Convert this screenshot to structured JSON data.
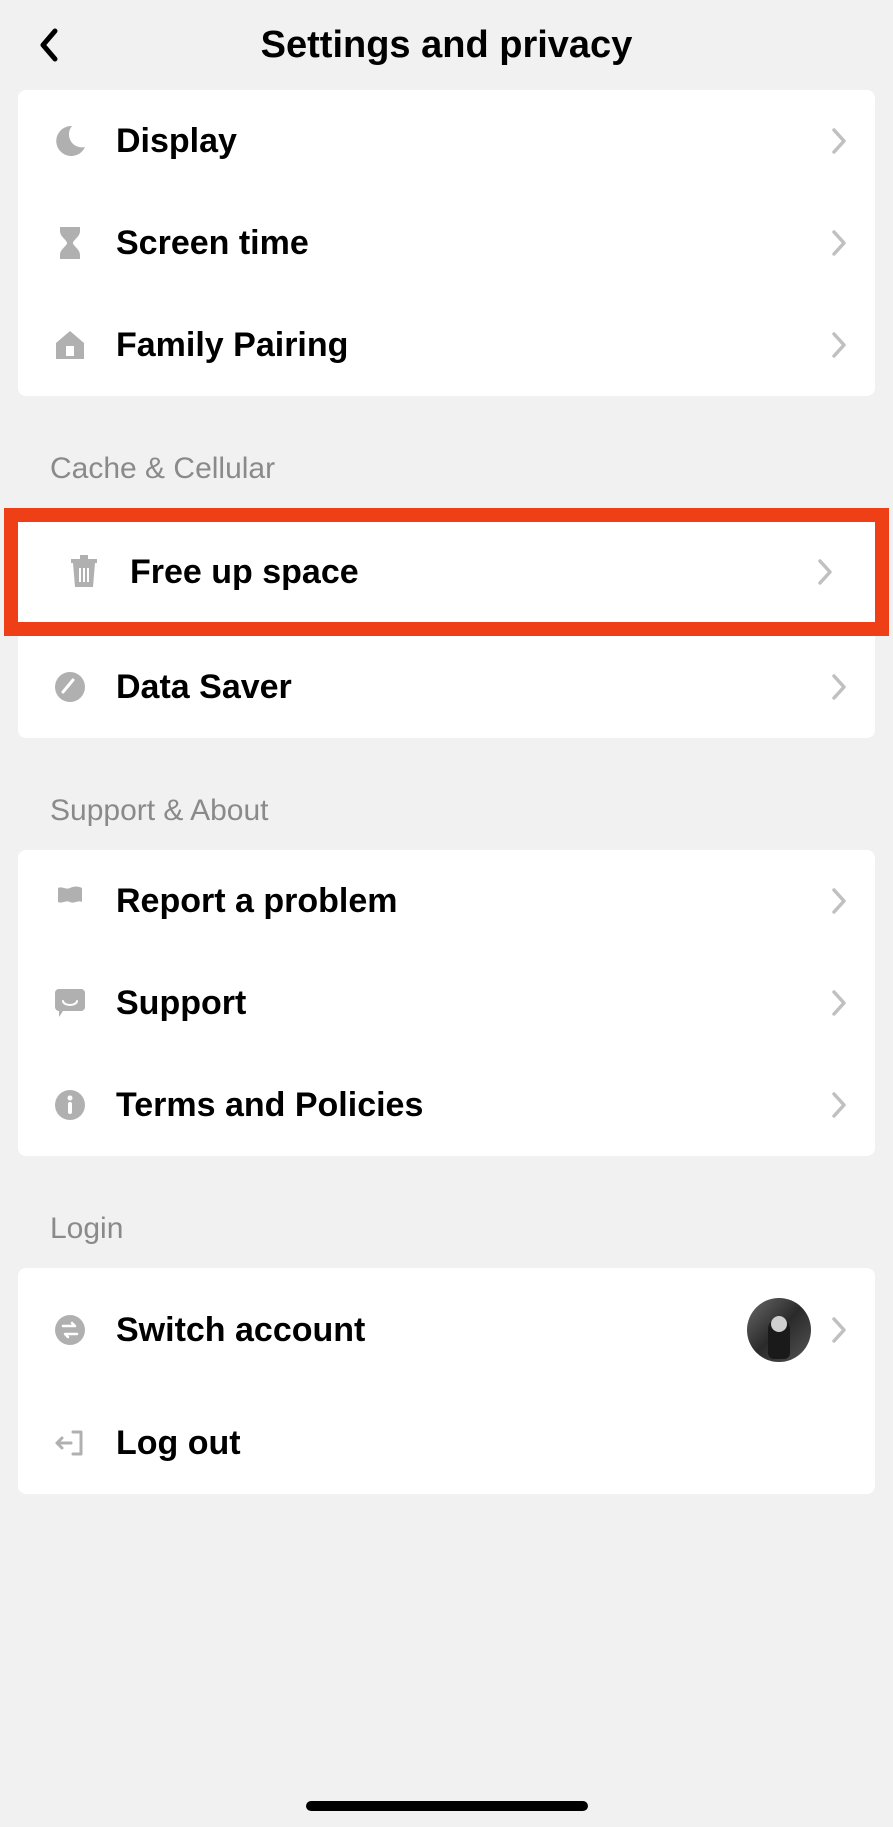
{
  "header": {
    "title": "Settings and privacy"
  },
  "section1": {
    "items": [
      {
        "label": "Display",
        "icon": "moon"
      },
      {
        "label": "Screen time",
        "icon": "hourglass"
      },
      {
        "label": "Family Pairing",
        "icon": "home"
      }
    ]
  },
  "section2": {
    "title": "Cache & Cellular",
    "items": [
      {
        "label": "Free up space",
        "icon": "trash",
        "highlight": true
      },
      {
        "label": "Data Saver",
        "icon": "gauge"
      }
    ]
  },
  "section3": {
    "title": "Support & About",
    "items": [
      {
        "label": "Report a problem",
        "icon": "flag"
      },
      {
        "label": "Support",
        "icon": "chat"
      },
      {
        "label": "Terms and Policies",
        "icon": "info"
      }
    ]
  },
  "section4": {
    "title": "Login",
    "items": [
      {
        "label": "Switch account",
        "icon": "switch",
        "avatar": true
      },
      {
        "label": "Log out",
        "icon": "logout",
        "no_chevron": true
      }
    ]
  }
}
